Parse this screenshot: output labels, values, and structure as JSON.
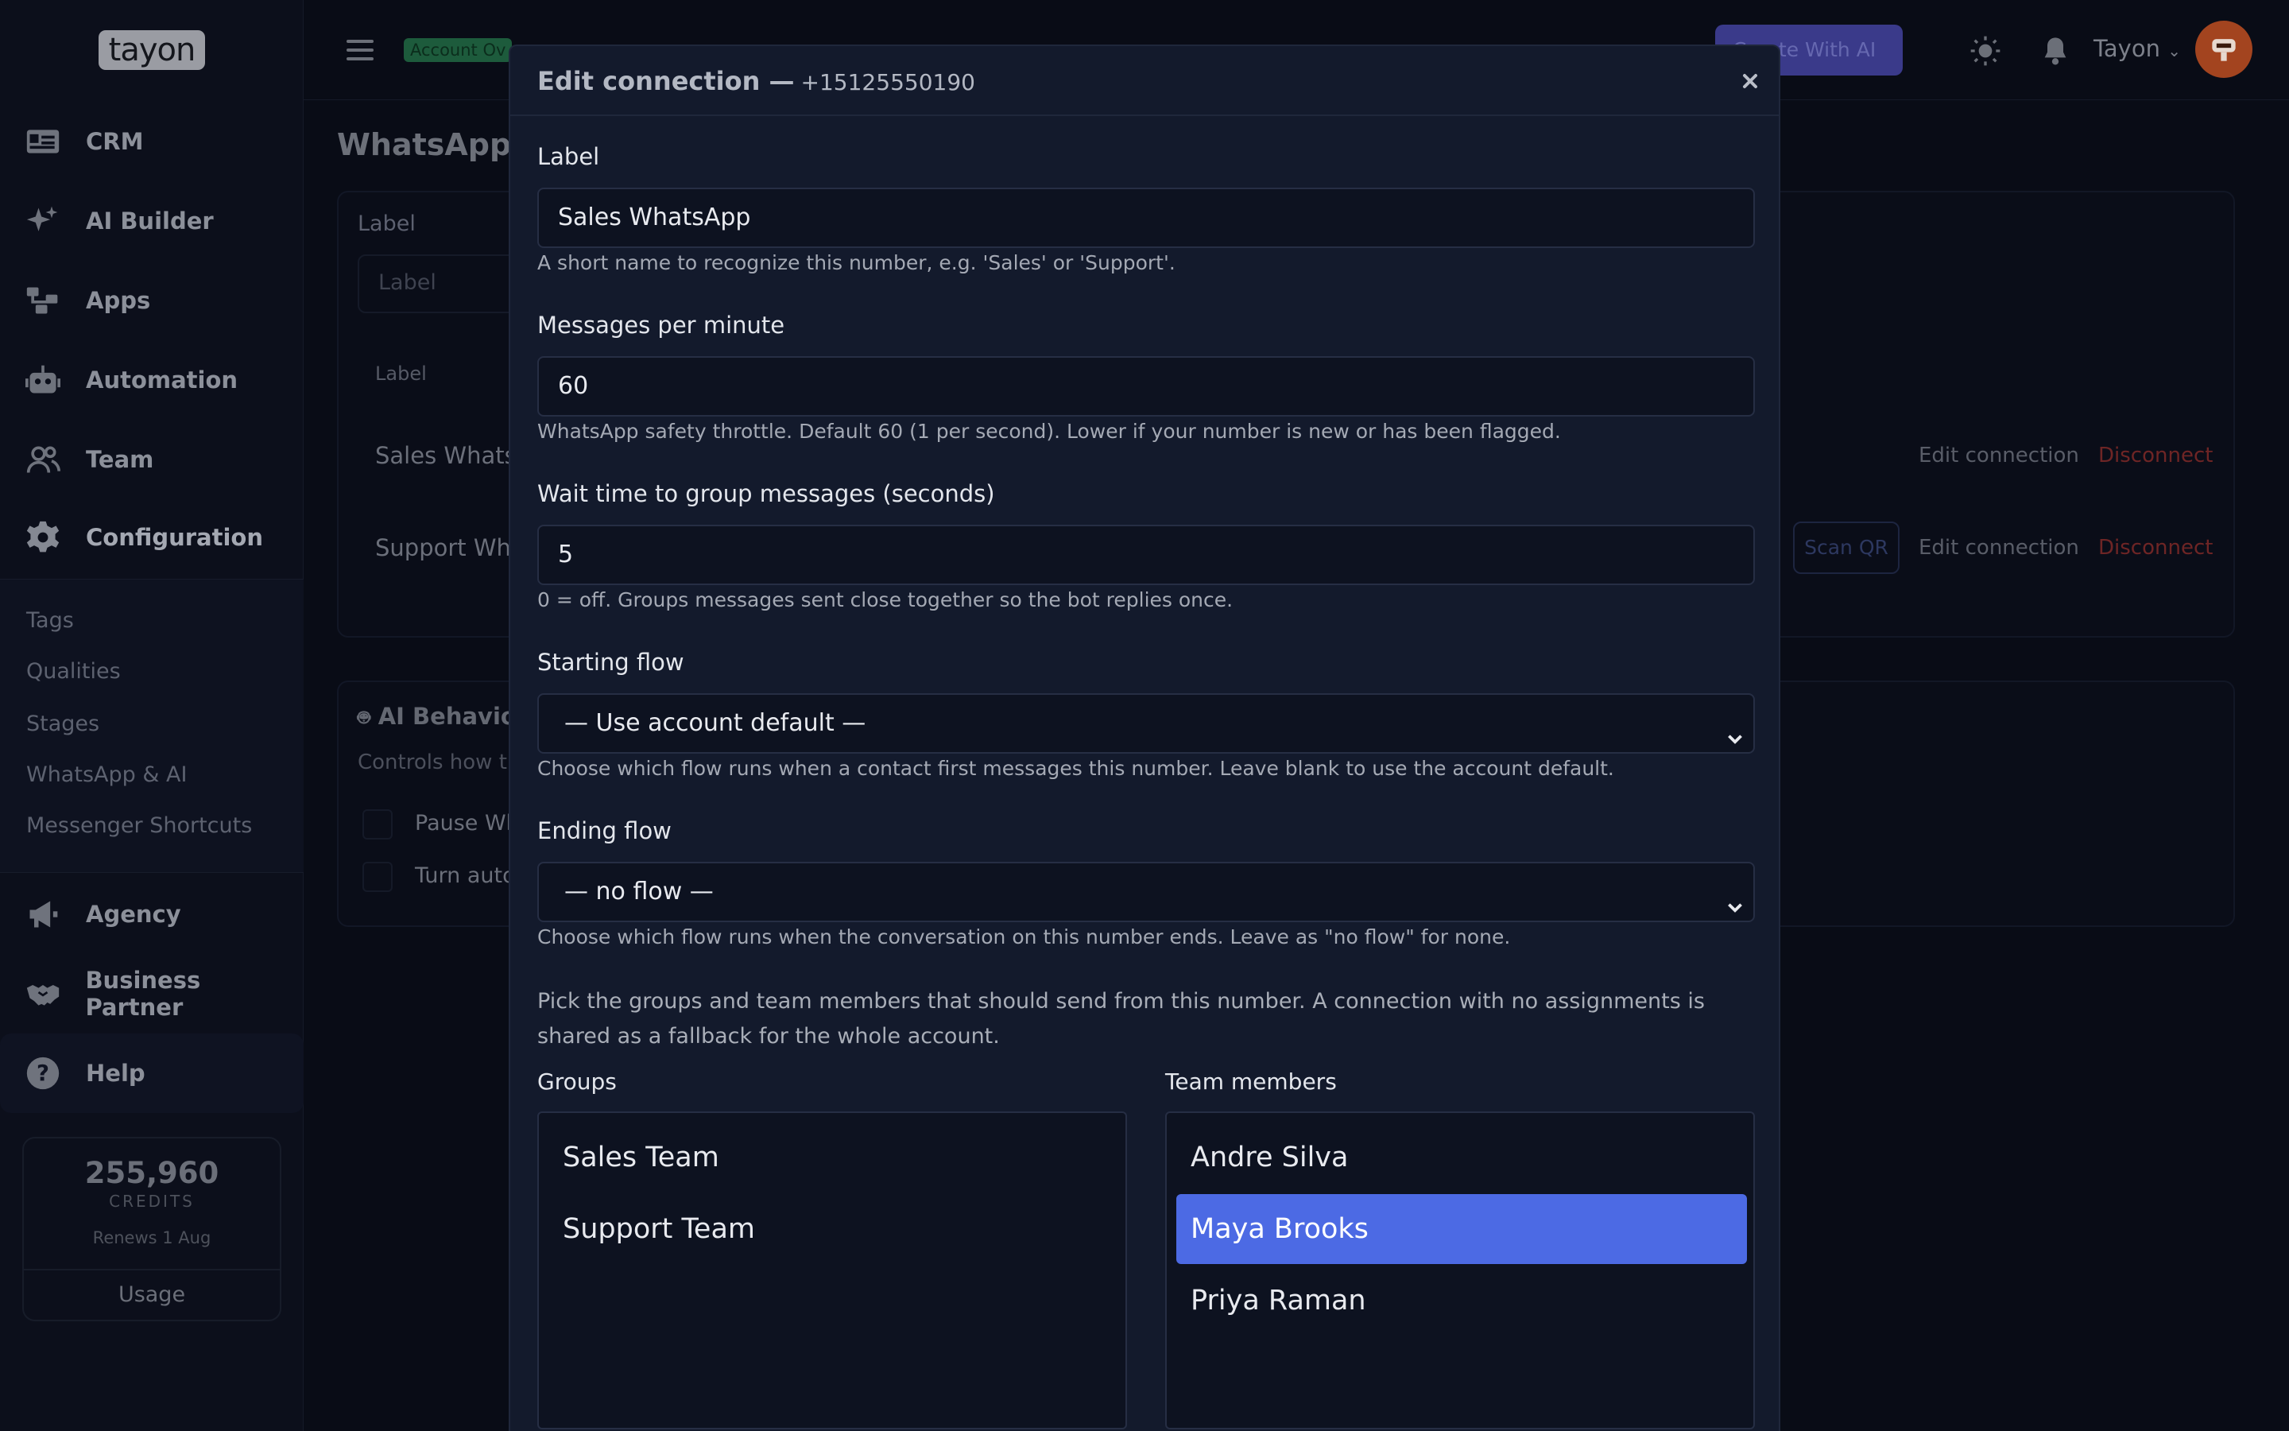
{
  "app": {
    "logo_text": "tayon"
  },
  "sidebar": {
    "items": [
      {
        "label": "CRM",
        "icon": "contact-card-icon"
      },
      {
        "label": "AI Builder",
        "icon": "sparkles-icon"
      },
      {
        "label": "Apps",
        "icon": "apps-icon"
      },
      {
        "label": "Automation",
        "icon": "robot-icon"
      },
      {
        "label": "Team",
        "icon": "team-icon"
      },
      {
        "label": "Configuration",
        "icon": "gear-icon"
      }
    ],
    "submenu": [
      "Tags",
      "Qualities",
      "Stages",
      "WhatsApp & AI",
      "Messenger Shortcuts"
    ],
    "bottom_items": [
      {
        "label": "Agency",
        "icon": "megaphone-icon"
      },
      {
        "label": "Business Partner",
        "icon": "handshake-icon"
      },
      {
        "label": "Help",
        "icon": "help-icon"
      }
    ],
    "credits": {
      "value": "255,960",
      "label": "CREDITS",
      "renews": "Renews 1 Aug",
      "usage_label": "Usage"
    }
  },
  "topbar": {
    "badge": "Account Ov",
    "create_label": "Create With AI",
    "user_name": "Tayon"
  },
  "background": {
    "page_title": "WhatsApp &",
    "label_heading": "Label",
    "label_placeholder": "Label",
    "table_header": "Label",
    "rows": [
      {
        "name": "Sales Whats",
        "edit": "Edit connection",
        "disconnect": "Disconnect"
      },
      {
        "name": "Support Wha",
        "scan": "Scan QR",
        "edit": "Edit connection",
        "disconnect": "Disconnect"
      }
    ],
    "ai_title": "AI Behavio",
    "ai_desc": "Controls how th",
    "toggles": [
      "Pause Wh",
      "Turn auto"
    ]
  },
  "modal": {
    "title": "Edit connection —",
    "phone": "+15125550190",
    "label": {
      "label": "Label",
      "value": "Sales WhatsApp",
      "help": "A short name to recognize this number, e.g. 'Sales' or 'Support'."
    },
    "rate": {
      "label": "Messages per minute",
      "value": "60",
      "help": "WhatsApp safety throttle. Default 60 (1 per second). Lower if your number is new or has been flagged."
    },
    "wait": {
      "label": "Wait time to group messages (seconds)",
      "value": "5",
      "help": "0 = off. Groups messages sent close together so the bot replies once."
    },
    "starting_flow": {
      "label": "Starting flow",
      "value": "— Use account default —",
      "help": "Choose which flow runs when a contact first messages this number. Leave blank to use the account default."
    },
    "ending_flow": {
      "label": "Ending flow",
      "value": "— no flow —",
      "help": "Choose which flow runs when the conversation on this number ends. Leave as \"no flow\" for none."
    },
    "assign_text": "Pick the groups and team members that should send from this number. A connection with no assignments is shared as a fallback for the whole account.",
    "groups": {
      "label": "Groups",
      "options": [
        "Sales Team",
        "Support Team"
      ]
    },
    "members": {
      "label": "Team members",
      "options": [
        "Andre Silva",
        "Maya Brooks",
        "Priya Raman"
      ],
      "selected": "Maya Brooks"
    }
  },
  "colors": {
    "accent": "#4c6ae4",
    "danger": "#c0392b",
    "background": "#090c16",
    "modal": "#131a2c"
  }
}
